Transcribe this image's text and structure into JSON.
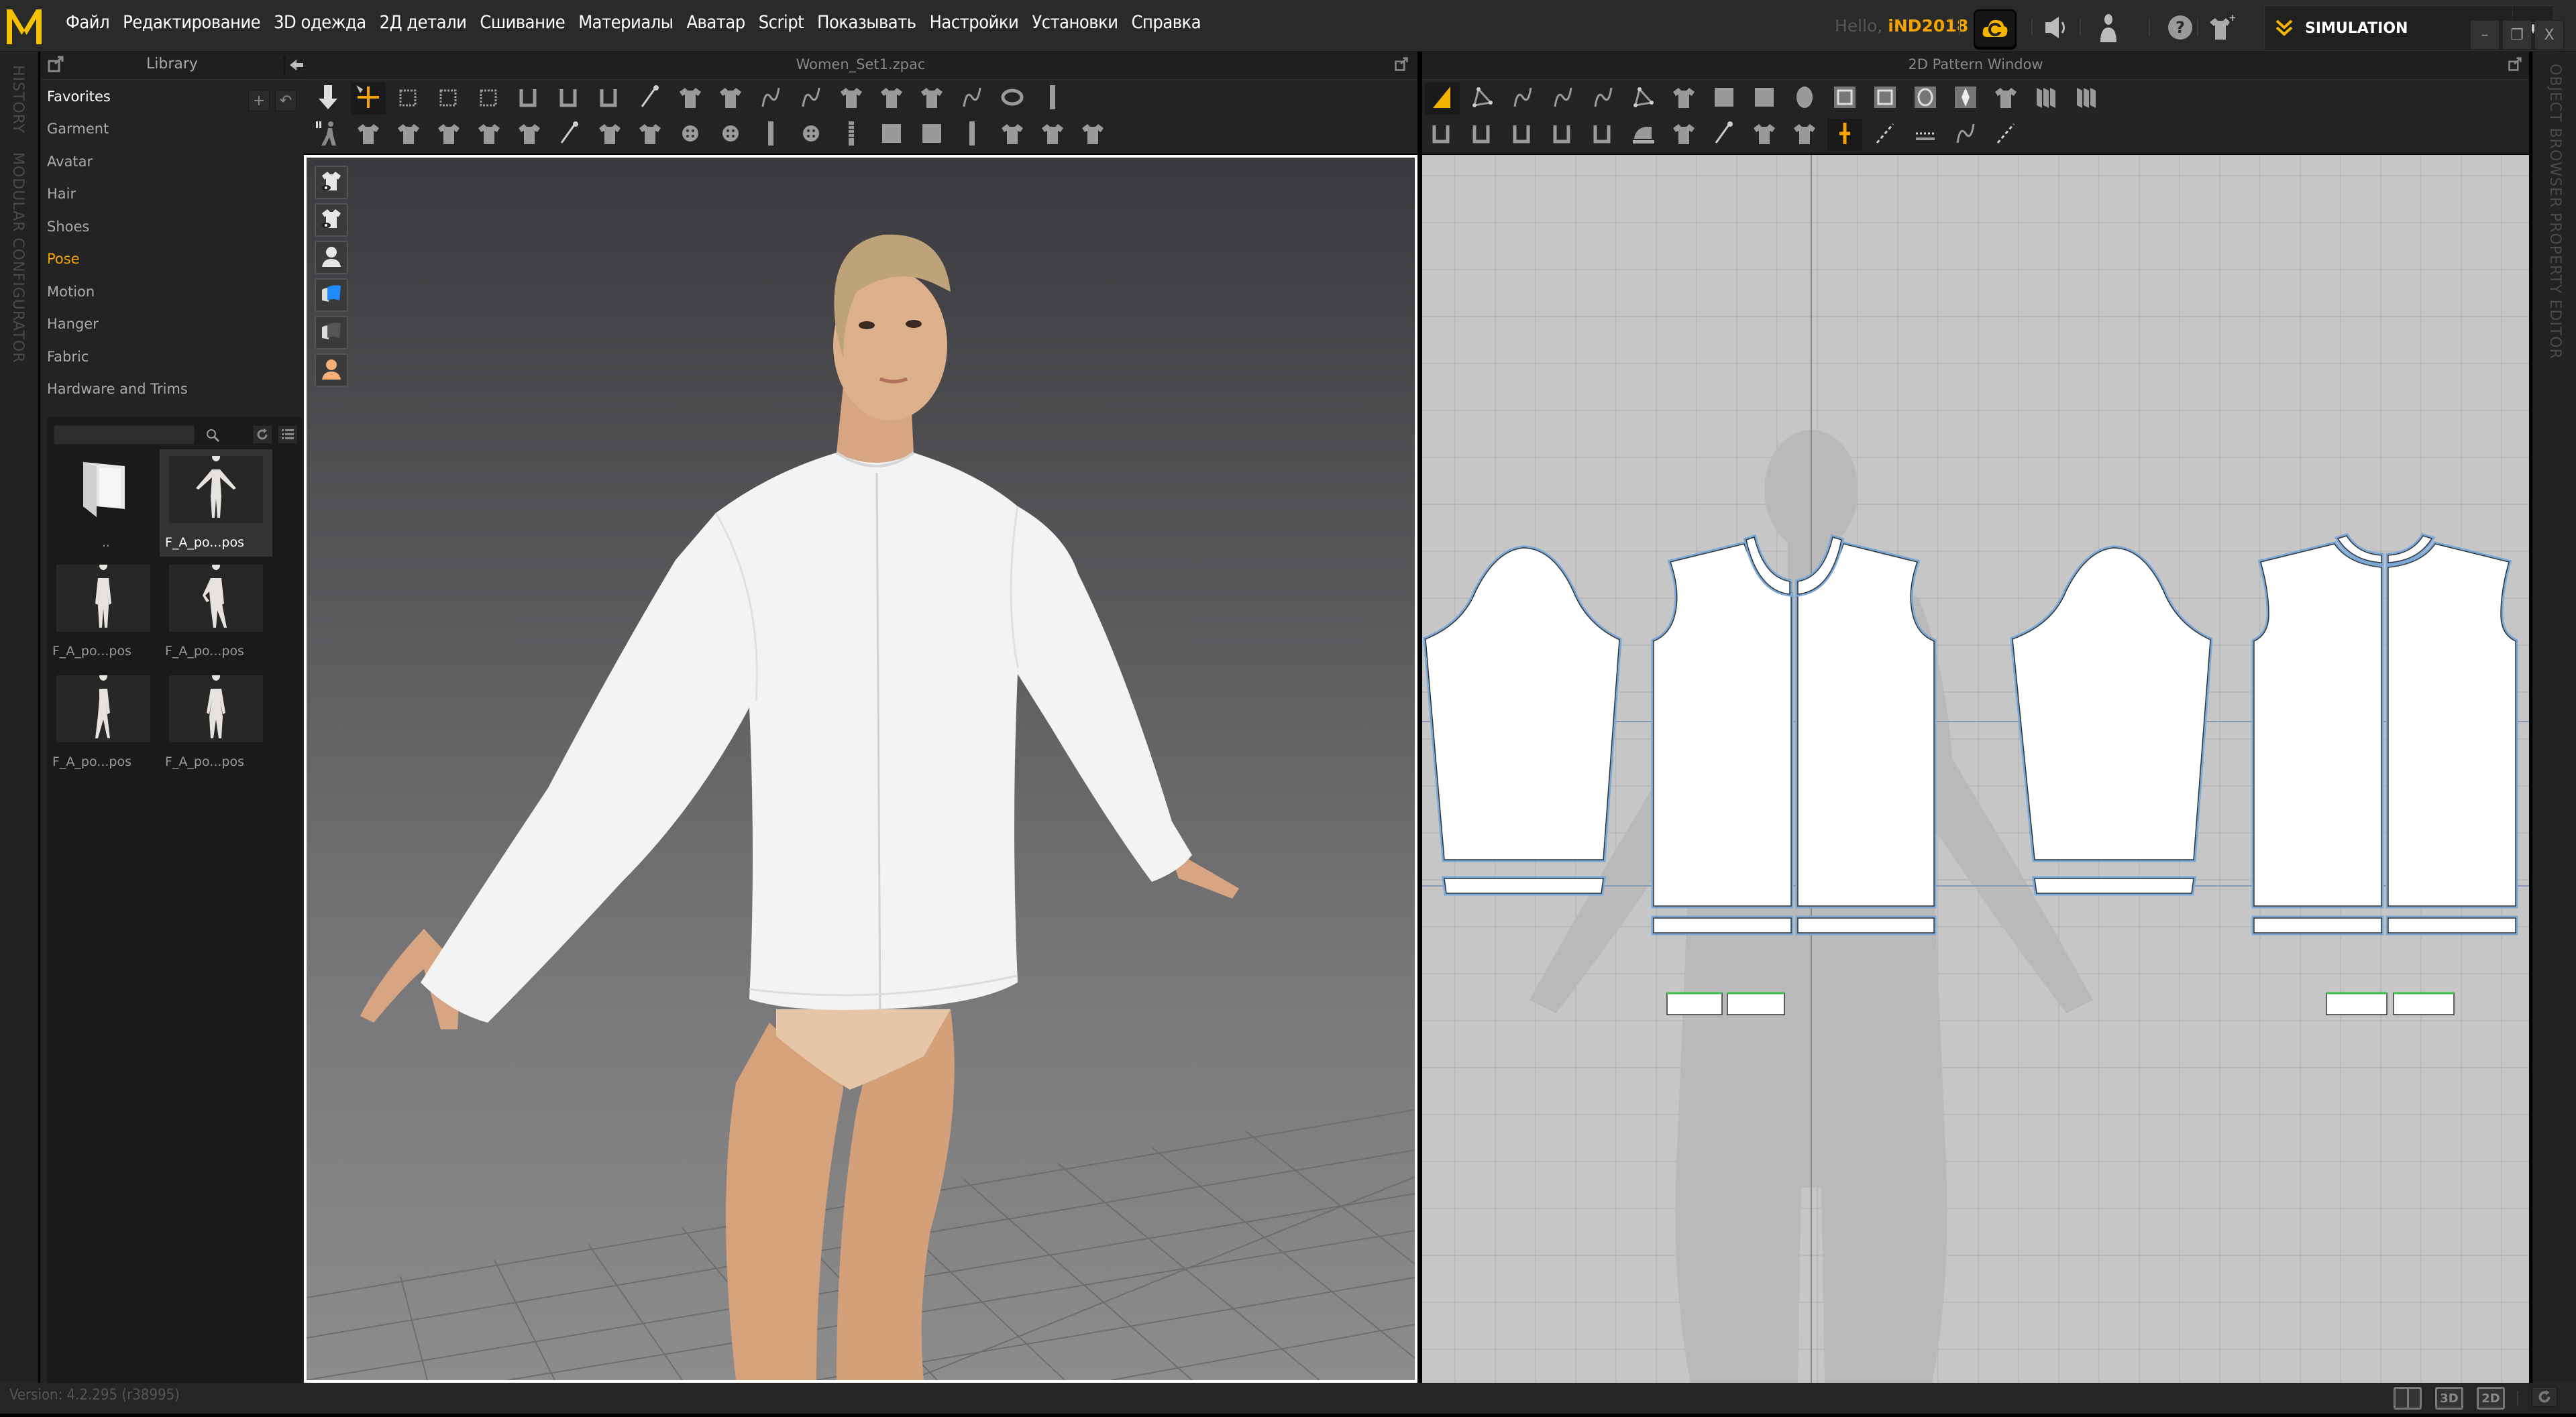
{
  "app": {
    "logo": "marvelous-designer-logo",
    "accent_color": "#f4a400",
    "menu": [
      "Файл",
      "Редактирование",
      "3D одежда",
      "2Д детали",
      "Сшивание",
      "Материалы",
      "Аватар",
      "Script",
      "Показывать",
      "Настройки",
      "Установки",
      "Справка"
    ],
    "greeting_prefix": "Hello,",
    "username": "iND2018",
    "top_icons": [
      "cloud-icon",
      "speaker-icon",
      "user-icon",
      "help-icon",
      "add-garment-icon"
    ],
    "mode": {
      "label": "SIMULATION",
      "dropdown": "▼"
    },
    "window_controls": {
      "minimize": "–",
      "restore": "❐",
      "close": "X"
    }
  },
  "left_strip": {
    "tabs": [
      "HISTORY",
      "MODULAR CONFIGURATOR"
    ]
  },
  "library": {
    "title": "Library",
    "favorites_label": "Favorites",
    "add_label": "+",
    "back_label": "↶",
    "categories": [
      {
        "label": "Garment",
        "active": false
      },
      {
        "label": "Avatar",
        "active": false
      },
      {
        "label": "Hair",
        "active": false
      },
      {
        "label": "Shoes",
        "active": false
      },
      {
        "label": "Pose",
        "active": true
      },
      {
        "label": "Motion",
        "active": false
      },
      {
        "label": "Hanger",
        "active": false
      },
      {
        "label": "Fabric",
        "active": false
      },
      {
        "label": "Hardware and Trims",
        "active": false
      }
    ],
    "search": {
      "value": "",
      "placeholder": ""
    },
    "items": [
      {
        "name": "..",
        "type": "folder",
        "selected": false
      },
      {
        "name": "F_A_po...pos",
        "type": "pose-a",
        "selected": true
      },
      {
        "name": "F_A_po...pos",
        "type": "pose-stand",
        "selected": false
      },
      {
        "name": "F_A_po...pos",
        "type": "pose-hip",
        "selected": false
      },
      {
        "name": "F_A_po...pos",
        "type": "pose-turn",
        "selected": false
      },
      {
        "name": "F_A_po...pos",
        "type": "pose-stand2",
        "selected": false
      }
    ]
  },
  "window3d": {
    "title": "Women_Set1.zpac",
    "side_tools": [
      "show-garment-icon",
      "show-garment-alt-icon",
      "show-avatar-icon",
      "texture-surface-icon",
      "shaded-surface-icon",
      "avatar-skin-icon"
    ]
  },
  "window2d": {
    "title": "2D Pattern Window"
  },
  "right_strip": {
    "tabs": [
      "OBJECT BROWSER",
      "PROPERTY EDITOR"
    ]
  },
  "status": {
    "version": "Version: 4.2.295 (r38995)",
    "view_buttons": [
      {
        "name": "split-view",
        "label": ""
      },
      {
        "name": "3d-view",
        "label": "3D"
      },
      {
        "name": "2d-view",
        "label": "2D"
      }
    ]
  }
}
